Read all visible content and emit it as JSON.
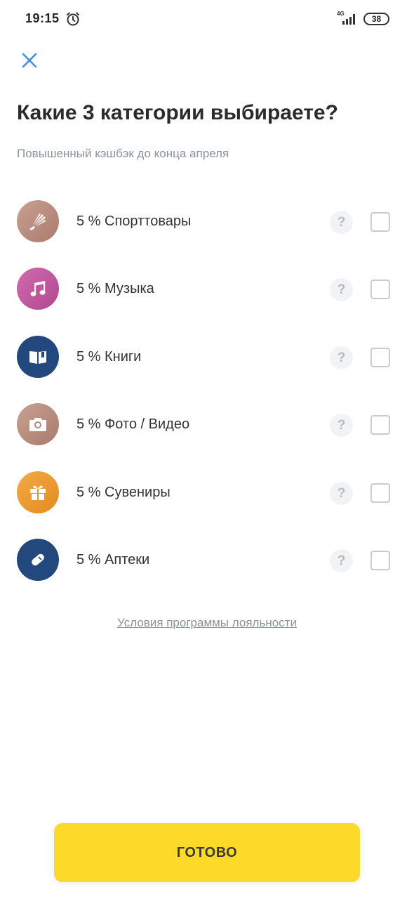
{
  "status_bar": {
    "time": "19:15",
    "network": "4G",
    "battery": "38"
  },
  "title": "Какие 3 категории выбираете?",
  "subtitle": "Повышенный кэшбэк до конца апреля",
  "categories": [
    {
      "label": "5 % Спорттовары",
      "icon": "badminton-shuttlecock-icon",
      "color": "#b5897a",
      "checked": false
    },
    {
      "label": "5 % Музыка",
      "icon": "music-note-icon",
      "color": "#c2589e",
      "checked": false
    },
    {
      "label": "5 % Книги",
      "icon": "book-icon",
      "color": "#22487d",
      "checked": false
    },
    {
      "label": "5 % Фото / Видео",
      "icon": "camera-icon",
      "color": "#b5897a",
      "checked": false
    },
    {
      "label": "5 % Сувениры",
      "icon": "gift-icon",
      "color": "#ec9a30",
      "checked": false
    },
    {
      "label": "5 % Аптеки",
      "icon": "pill-icon",
      "color": "#22487d",
      "checked": false
    }
  ],
  "help_symbol": "?",
  "terms_link": "Условия программы лояльности",
  "done_button": "ГОТОВО",
  "colors": {
    "accent_button": "#fdd92a",
    "close_icon": "#3d8fe0",
    "muted_text": "#8a929c"
  }
}
